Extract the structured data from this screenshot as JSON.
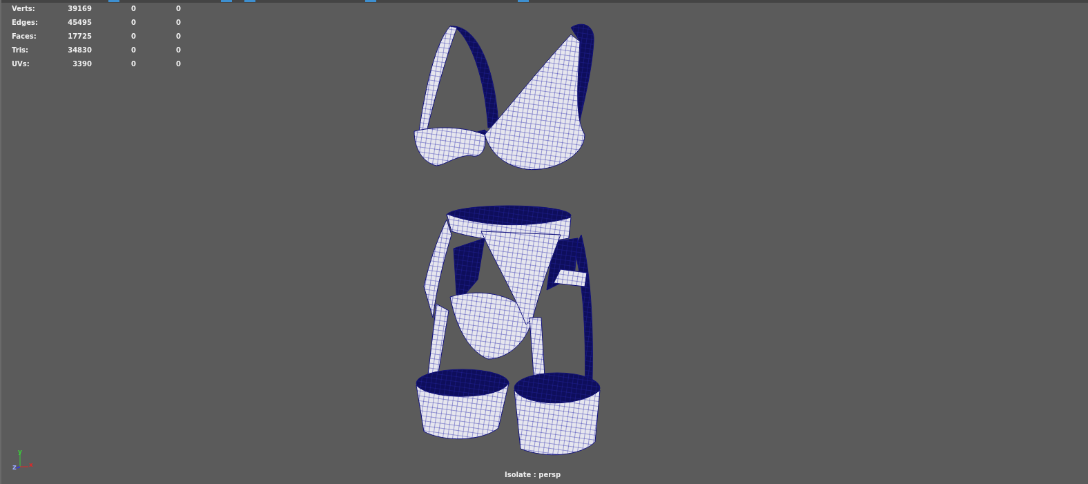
{
  "heads_up_display": {
    "rows": [
      {
        "label": "Verts:",
        "values": [
          "39169",
          "0",
          "0"
        ]
      },
      {
        "label": "Edges:",
        "values": [
          "45495",
          "0",
          "0"
        ]
      },
      {
        "label": "Faces:",
        "values": [
          "17725",
          "0",
          "0"
        ]
      },
      {
        "label": "Tris:",
        "values": [
          "34830",
          "0",
          "0"
        ]
      },
      {
        "label": "UVs:",
        "values": [
          "3390",
          "0",
          "0"
        ]
      }
    ]
  },
  "axis_gizmo": {
    "x": "x",
    "y": "y",
    "z": "z"
  },
  "viewport_label": "Isolate : persp"
}
